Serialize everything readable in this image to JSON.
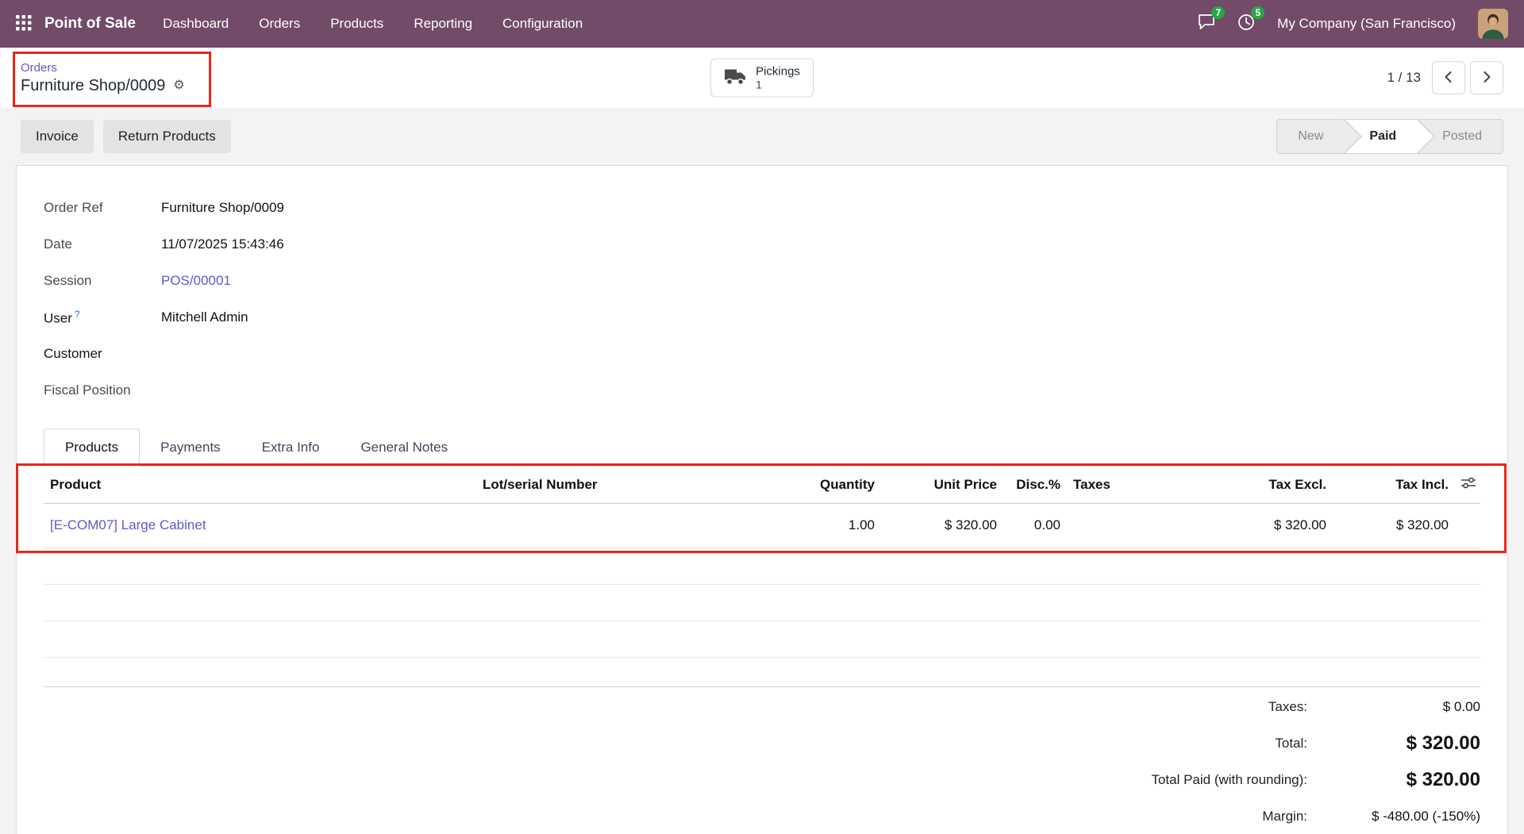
{
  "colors": {
    "navbar_bg": "#714B67",
    "link": "#5D5AC9",
    "badge_green": "#28a745",
    "annotation_red": "#E8271C"
  },
  "navbar": {
    "app_name": "Point of Sale",
    "menus": [
      "Dashboard",
      "Orders",
      "Products",
      "Reporting",
      "Configuration"
    ],
    "messages_count": "7",
    "activities_count": "5",
    "company": "My Company (San Francisco)"
  },
  "breadcrumb": {
    "parent": "Orders",
    "current": "Furniture Shop/0009"
  },
  "control": {
    "pickings_label": "Pickings",
    "pickings_count": "1",
    "pager": "1 / 13"
  },
  "buttons": {
    "invoice": "Invoice",
    "return_products": "Return Products"
  },
  "statusbar": {
    "steps": [
      {
        "label": "New",
        "active": false
      },
      {
        "label": "Paid",
        "active": true
      },
      {
        "label": "Posted",
        "active": false
      }
    ]
  },
  "form": {
    "fields": [
      {
        "label": "Order Ref",
        "value": "Furniture Shop/0009"
      },
      {
        "label": "Date",
        "value": "11/07/2025 15:43:46"
      },
      {
        "label": "Session",
        "value": "POS/00001"
      },
      {
        "label": "User",
        "value": "Mitchell Admin",
        "help": "?"
      },
      {
        "label": "Customer",
        "value": ""
      },
      {
        "label": "Fiscal Position",
        "value": ""
      }
    ]
  },
  "tabs": [
    {
      "label": "Products",
      "active": true
    },
    {
      "label": "Payments",
      "active": false
    },
    {
      "label": "Extra Info",
      "active": false
    },
    {
      "label": "General Notes",
      "active": false
    }
  ],
  "table": {
    "headers": [
      "Product",
      "Lot/serial Number",
      "Quantity",
      "Unit Price",
      "Disc.%",
      "Taxes",
      "Tax Excl.",
      "Tax Incl."
    ],
    "rows": [
      {
        "cells": [
          "[E-COM07] Large Cabinet",
          "",
          "1.00",
          "$ 320.00",
          "0.00",
          "",
          "$ 320.00",
          "$ 320.00"
        ]
      }
    ]
  },
  "totals": {
    "rows": [
      {
        "label": "Taxes:",
        "value": "$ 0.00"
      },
      {
        "label": "Total:",
        "value": "$ 320.00"
      },
      {
        "label": "Total Paid (with rounding):",
        "value": "$ 320.00"
      },
      {
        "label": "Margin:",
        "value": "$ -480.00 (-150%)"
      }
    ]
  },
  "icons": {
    "gear": "⚙"
  }
}
